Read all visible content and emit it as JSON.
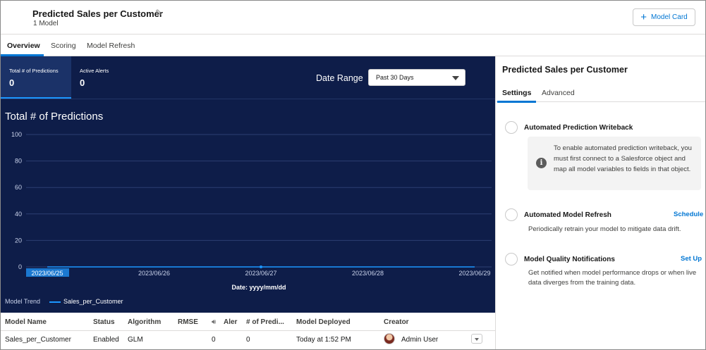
{
  "header": {
    "title": "Predicted Sales per Customer",
    "subtitle": "1 Model",
    "model_card_button": "Model Card"
  },
  "tabs": [
    {
      "label": "Overview",
      "active": true
    },
    {
      "label": "Scoring",
      "active": false
    },
    {
      "label": "Model Refresh",
      "active": false
    }
  ],
  "kpis": [
    {
      "label": "Total # of Predictions",
      "value": "0",
      "selected": true
    },
    {
      "label": "Active Alerts",
      "value": "0",
      "selected": false
    }
  ],
  "date_range": {
    "label": "Date Range",
    "selected": "Past 30 Days"
  },
  "chart_data": {
    "type": "line",
    "title": "Total # of Predictions",
    "xlabel": "Date: yyyy/mm/dd",
    "ylabel": "",
    "ylim": [
      0,
      100
    ],
    "yticks": [
      0,
      20,
      40,
      60,
      80,
      100
    ],
    "categories": [
      "2023/06/25",
      "2023/06/26",
      "2023/06/27",
      "2023/06/28",
      "2023/06/29"
    ],
    "highlighted_category": "2023/06/25",
    "series": [
      {
        "name": "Sales_per_Customer",
        "values": [
          0,
          0,
          0,
          0,
          0
        ],
        "color": "#1b96ff"
      }
    ],
    "grid": true,
    "legend_title": "Model Trend",
    "legend_position": "bottom-left"
  },
  "table": {
    "columns": [
      "Model Name",
      "Status",
      "Algorithm",
      "RMSE",
      "Aler",
      "# of Predi...",
      "Model Deployed",
      "Creator"
    ],
    "rows": [
      {
        "model_name": "Sales_per_Customer",
        "status": "Enabled",
        "algorithm": "GLM",
        "rmse": "",
        "alerts": "0",
        "predictions": "0",
        "deployed": "Today at 1:52 PM",
        "creator": "Admin User"
      }
    ]
  },
  "right_panel": {
    "title": "Predicted Sales per Customer",
    "tabs": [
      {
        "label": "Settings",
        "active": true
      },
      {
        "label": "Advanced",
        "active": false
      }
    ],
    "options": [
      {
        "title": "Automated Prediction Writeback",
        "link": "",
        "description": ""
      },
      {
        "title": "Automated Model Refresh",
        "link": "Schedule",
        "description": "Periodically retrain your model to mitigate data drift."
      },
      {
        "title": "Model Quality Notifications",
        "link": "Set Up",
        "description": "Get notified when model performance drops or when live data diverges from the training data."
      }
    ],
    "info_message": "To enable automated prediction writeback, you must first connect to a Salesforce object and map all model variables to fields in that object."
  },
  "colors": {
    "dark_bg": "#0e1d49",
    "accent": "#0176d3",
    "series": "#1b96ff"
  }
}
